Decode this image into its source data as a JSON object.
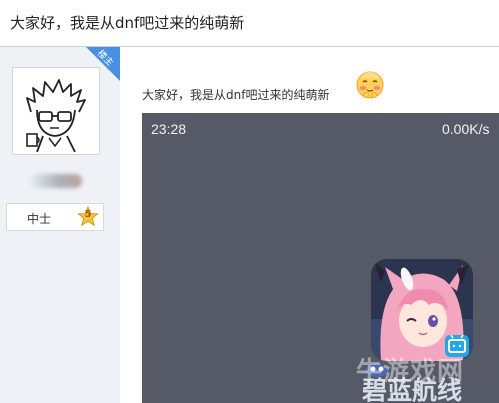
{
  "thread": {
    "title": "大家好，我是从dnf吧过来的纯萌新"
  },
  "author": {
    "avatar_icon": "sketch-boy-avatar-icon",
    "rank_title": "中士",
    "rank_level": "5",
    "corner_tag": "楼主"
  },
  "post": {
    "text": "大家好，我是从dnf吧过来的纯萌新",
    "emoji_icon": "shy-blushing-face-icon"
  },
  "video": {
    "time": "23:28",
    "speed": "0.00K/s",
    "app_icon": "anime-girl-app-icon"
  },
  "watermark": {
    "line1": "牛游戏网",
    "line2": "碧蓝航线"
  },
  "colors": {
    "video_bg": "#565a66",
    "left_col_bg": "#eef1f5",
    "corner_tag": "#4a90e2",
    "badge_gold": "#f4c542"
  }
}
